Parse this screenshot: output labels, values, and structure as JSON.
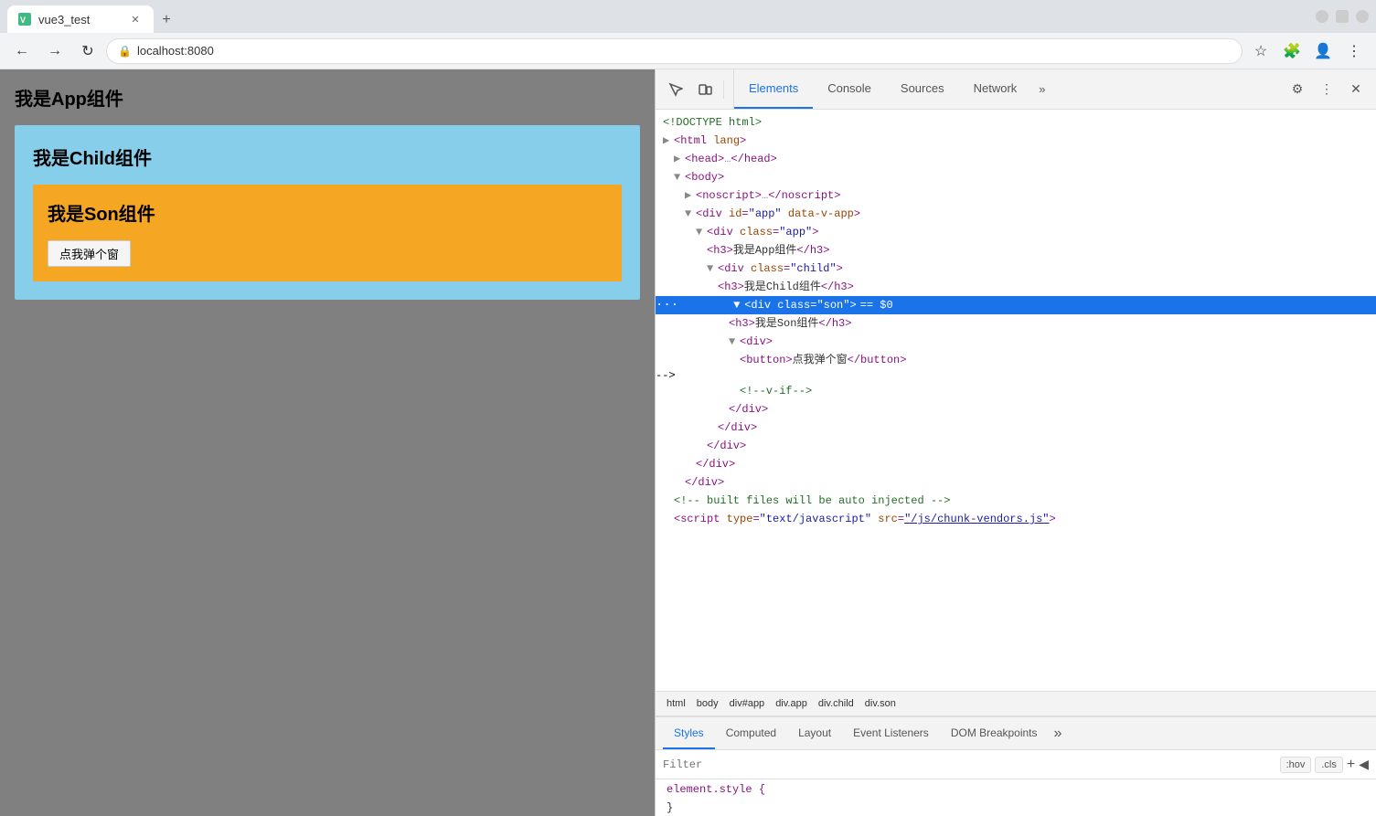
{
  "browser": {
    "tab_title": "vue3_test",
    "tab_url": "localhost:8080",
    "new_tab_label": "+"
  },
  "page": {
    "app_heading": "我是App组件",
    "child_heading": "我是Child组件",
    "son_heading": "我是Son组件",
    "button_label": "点我弹个窗"
  },
  "devtools": {
    "tabs": [
      "Elements",
      "Console",
      "Sources",
      "Network"
    ],
    "more_tabs_icon": "»",
    "settings_icon": "⚙",
    "more_options_icon": "⋮",
    "close_icon": "✕",
    "inspect_icon": "cursor",
    "device_icon": "device"
  },
  "dom": {
    "lines": [
      {
        "indent": 0,
        "content": "<!DOCTYPE html>",
        "type": "comment"
      },
      {
        "indent": 0,
        "content": "<html lang>",
        "type": "tag"
      },
      {
        "indent": 1,
        "toggle": "▶",
        "content": "<head>…</head>",
        "type": "collapsed"
      },
      {
        "indent": 1,
        "toggle": "▼",
        "content": "<body>",
        "type": "tag"
      },
      {
        "indent": 2,
        "toggle": "▶",
        "content": "<noscript>…</noscript>",
        "type": "collapsed"
      },
      {
        "indent": 2,
        "toggle": "▼",
        "content": "<div id=\"app\" data-v-app>",
        "type": "tag"
      },
      {
        "indent": 3,
        "toggle": "▼",
        "content": "<div class=\"app\">",
        "type": "tag"
      },
      {
        "indent": 4,
        "content": "<h3>我是App组件</h3>",
        "type": "inline"
      },
      {
        "indent": 4,
        "toggle": "▼",
        "content": "<div class=\"child\">",
        "type": "tag"
      },
      {
        "indent": 5,
        "content": "<h3>我是Child组件</h3>",
        "type": "inline"
      },
      {
        "indent": 5,
        "toggle": "▼",
        "content": "<div class=\"son\"> == $0",
        "type": "selected"
      },
      {
        "indent": 6,
        "content": "<h3>我是Son组件</h3>",
        "type": "inline"
      },
      {
        "indent": 6,
        "toggle": "▼",
        "content": "<div>",
        "type": "tag"
      },
      {
        "indent": 7,
        "content": "<button>点我弹个窗</button>",
        "type": "inline"
      },
      {
        "indent": 7,
        "content": "<!--v-if-->",
        "type": "comment"
      },
      {
        "indent": 6,
        "content": "</div>",
        "type": "close"
      },
      {
        "indent": 5,
        "content": "</div>",
        "type": "close"
      },
      {
        "indent": 4,
        "content": "</div>",
        "type": "close"
      },
      {
        "indent": 3,
        "content": "</div>",
        "type": "close"
      },
      {
        "indent": 2,
        "content": "</div>",
        "type": "close"
      },
      {
        "indent": 1,
        "content": "<!-- built files will be auto injected -->",
        "type": "comment"
      },
      {
        "indent": 1,
        "content": "<script type=\"text/javascript\" src=\"/js/chunk-vendors.js\">",
        "type": "tag"
      }
    ]
  },
  "breadcrumb": {
    "items": [
      "html",
      "body",
      "div#app",
      "div.app",
      "div.child",
      "div.son"
    ]
  },
  "bottom_tabs": {
    "tabs": [
      "Styles",
      "Computed",
      "Layout",
      "Event Listeners",
      "DOM Breakpoints"
    ],
    "more": "»",
    "active": "Styles"
  },
  "styles": {
    "filter_placeholder": "Filter",
    "hov_label": ":hov",
    "cls_label": ".cls",
    "plus_label": "+",
    "sidebar_label": "◀",
    "rule": "element.style {",
    "rule_close": "}"
  }
}
